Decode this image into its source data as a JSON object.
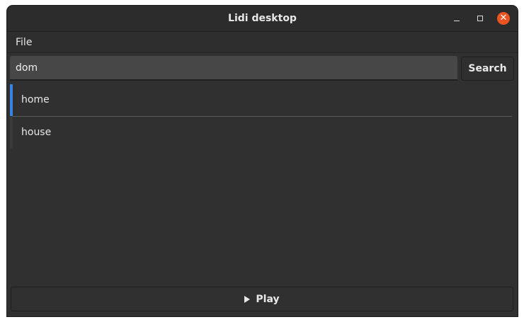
{
  "window": {
    "title": "Lidi desktop",
    "controls": {
      "minimize": "minimize-icon",
      "maximize": "maximize-icon",
      "close": "close-icon"
    },
    "close_color": "#e95420"
  },
  "menubar": {
    "items": [
      {
        "label": "File"
      }
    ]
  },
  "search": {
    "value": "dom",
    "button_label": "Search"
  },
  "results": {
    "items": [
      {
        "label": "home",
        "selected": true
      },
      {
        "label": "house",
        "selected": false
      }
    ],
    "selection_color": "#3584e4"
  },
  "player": {
    "button_label": "Play",
    "icon": "play-icon"
  }
}
